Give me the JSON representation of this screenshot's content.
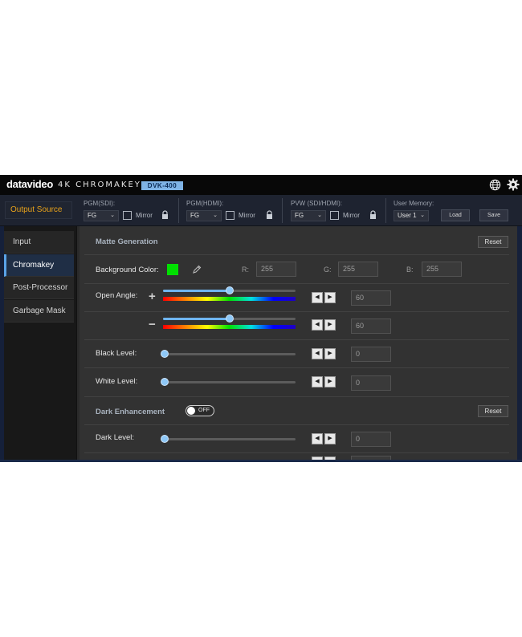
{
  "header": {
    "logo": "datavideo",
    "product": "4K CHROMAKEY",
    "model": "DVK-400"
  },
  "output_source": {
    "label": "Output Source",
    "pgm_sdi": {
      "title": "PGM(SDI):",
      "value": "FG",
      "mirror_label": "Mirror"
    },
    "pgm_hdmi": {
      "title": "PGM(HDMI):",
      "value": "FG",
      "mirror_label": "Mirror"
    },
    "pvw": {
      "title": "PVW (SDI/HDMI):",
      "value": "FG",
      "mirror_label": "Mirror"
    },
    "user_memory": {
      "title": "User Memory:",
      "value": "User 1",
      "load_label": "Load",
      "save_label": "Save"
    }
  },
  "sidebar": {
    "items": [
      {
        "label": "Input"
      },
      {
        "label": "Chromakey"
      },
      {
        "label": "Post-Processor"
      },
      {
        "label": "Garbage Mask"
      }
    ],
    "active": "Chromakey"
  },
  "matte": {
    "title": "Matte Generation",
    "reset_label": "Reset",
    "background_color": {
      "label": "Background Color:",
      "swatch": "#00e000",
      "r_label": "R:",
      "r": "255",
      "g_label": "G:",
      "g": "255",
      "b_label": "B:",
      "b": "255"
    },
    "open_angle": {
      "label": "Open Angle:",
      "plus_sign": "+",
      "plus_value": "60",
      "plus_level": 0.5,
      "minus_sign": "−",
      "minus_value": "60",
      "minus_level": 0.5
    },
    "black_level": {
      "label": "Black Level:",
      "value": "0",
      "level": 0
    },
    "white_level": {
      "label": "White Level:",
      "value": "0",
      "level": 0
    }
  },
  "dark_enhancement": {
    "title": "Dark Enhancement",
    "toggle": "OFF",
    "reset_label": "Reset",
    "dark_level": {
      "label": "Dark Level:",
      "value": "0",
      "level": 0
    }
  },
  "colors": {
    "accent": "#e8a21a",
    "active_tab": "#5aa3e8",
    "slider": "#8ec8f7"
  }
}
